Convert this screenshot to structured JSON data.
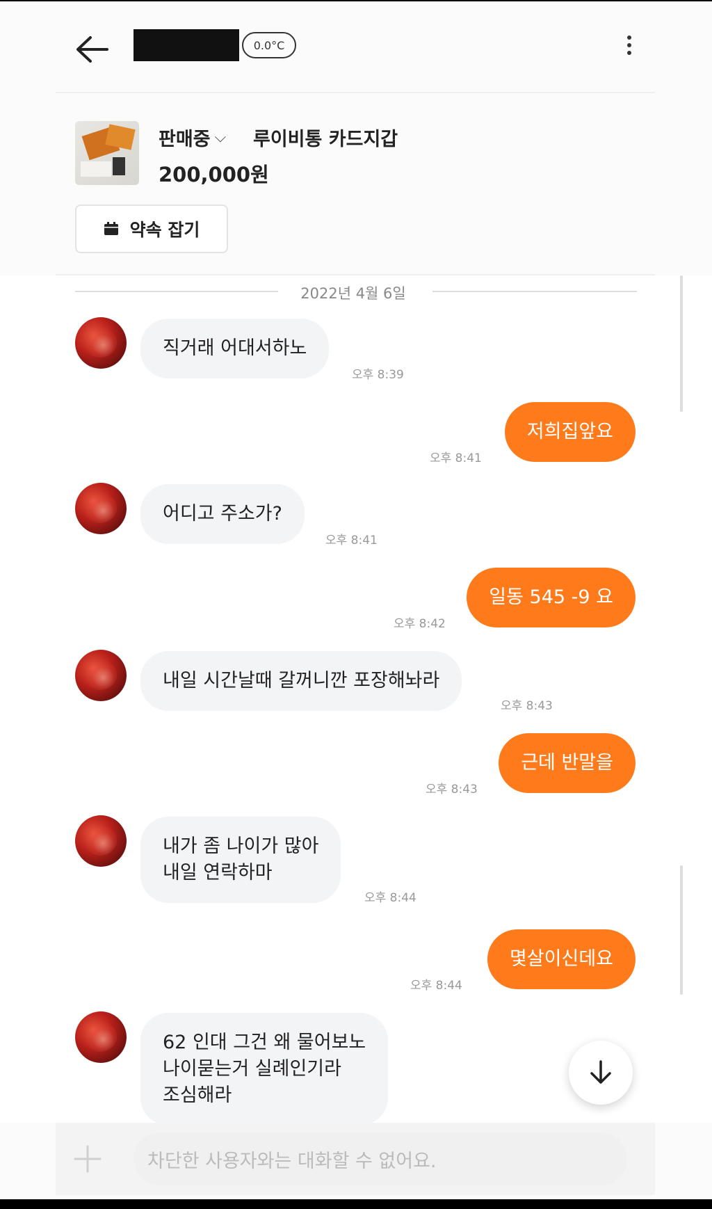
{
  "header": {
    "temperature": "0.0°C"
  },
  "product": {
    "status": "판매중",
    "title": "루이비통 카드지갑",
    "price": "200,000원",
    "appointment_label": "약속 잡기"
  },
  "chat": {
    "date": "2022년 4월 6일",
    "messages": [
      {
        "text": "직거래 어대서하노",
        "time": "오후 8:39"
      },
      {
        "text": "저희집앞요",
        "time": "오후 8:41"
      },
      {
        "text": "어디고 주소가?",
        "time": "오후 8:41"
      },
      {
        "text": "일동 545 -9 요",
        "time": "오후 8:42"
      },
      {
        "text": "내일 시간날때 갈꺼니깐 포장해놔라",
        "time": "오후 8:43"
      },
      {
        "text": "근데 반말을",
        "time": "오후 8:43"
      },
      {
        "text": "내가 좀 나이가 많아\n내일 연락하마",
        "time": "오후 8:44"
      },
      {
        "text": "몇살이신데요",
        "time": "오후 8:44"
      },
      {
        "text": "62 인대 그건 왜 물어보노\n나이묻는거 실례인기라\n조심해라",
        "time": ""
      }
    ]
  },
  "input": {
    "placeholder": "차단한 사용자와는 대화할 수 없어요."
  },
  "colors": {
    "accent": "#ff7a1a",
    "incoming_bubble": "#f3f4f6"
  }
}
